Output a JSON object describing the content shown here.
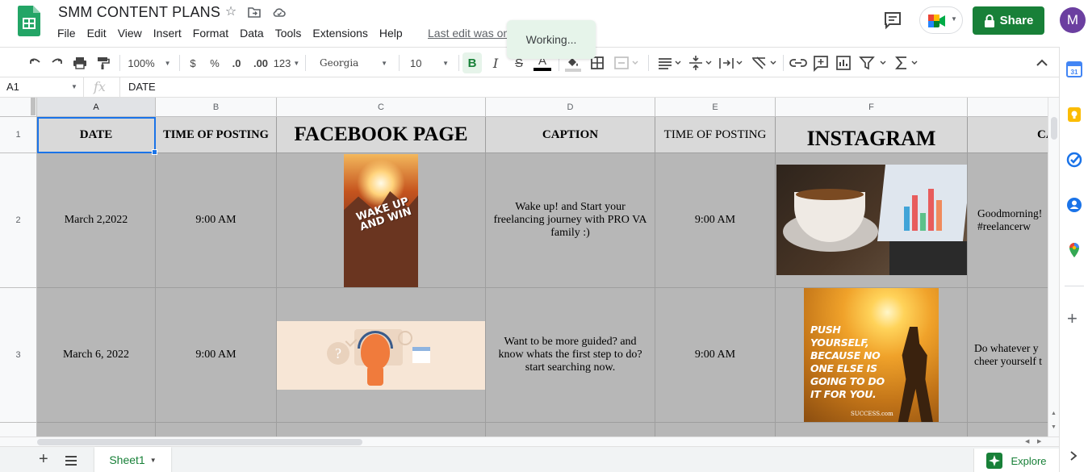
{
  "header": {
    "title": "SMM CONTENT PLANS",
    "menu": [
      "File",
      "Edit",
      "View",
      "Insert",
      "Format",
      "Data",
      "Tools",
      "Extensions",
      "Help"
    ],
    "last_edit": "Last edit was on",
    "working": "Working...",
    "share_label": "Share",
    "avatar_letter": "M"
  },
  "toolbar": {
    "zoom": "100%",
    "currency": "$",
    "percent": "%",
    "dec_less": ".0",
    "dec_more": ".00",
    "number_format": "123",
    "font": "Georgia",
    "font_size": "10",
    "bold": "B",
    "italic": "I",
    "strike": "S",
    "text_color": "A"
  },
  "formula_bar": {
    "cell_ref": "A1",
    "fx": "fx",
    "value": "DATE"
  },
  "grid": {
    "columns": [
      "A",
      "B",
      "C",
      "D",
      "E",
      "F",
      ""
    ],
    "rows": [
      "1",
      "2",
      "3",
      ""
    ],
    "header_row": {
      "date": "DATE",
      "time1": "TIME OF POSTING",
      "facebook": "FACEBOOK PAGE",
      "caption": "CAPTION",
      "time2": "TIME OF POSTING",
      "instagram": "INSTAGRAM",
      "caption2": "CAP"
    },
    "row2": {
      "date": "March 2,2022",
      "time1": "9:00 AM",
      "fb_image_text": "WAKE UP AND WIN",
      "caption": "Wake up! and Start your freelancing journey with PRO VA family :)",
      "time2": "9:00 AM",
      "caption2": "Goodmorning! #reelancerw"
    },
    "row3": {
      "date": "March 6, 2022",
      "time1": "9:00 AM",
      "caption": "Want to be more guided? and know whats the first step to do? start searching now.",
      "time2": "9:00 AM",
      "ig_image_text": "PUSH YOURSELF, BECAUSE NO ONE ELSE IS GOING TO DO IT FOR YOU.",
      "ig_image_brand": "SUCCESS.com",
      "caption2": "Do whatever y cheer yourself t"
    }
  },
  "sheetbar": {
    "sheet_name": "Sheet1",
    "explore_label": "Explore"
  },
  "colors": {
    "brand_green": "#188038",
    "selection_blue": "#1a73e8",
    "header_cell": "#d9d9d9",
    "data_cell": "#b7b7b7"
  }
}
